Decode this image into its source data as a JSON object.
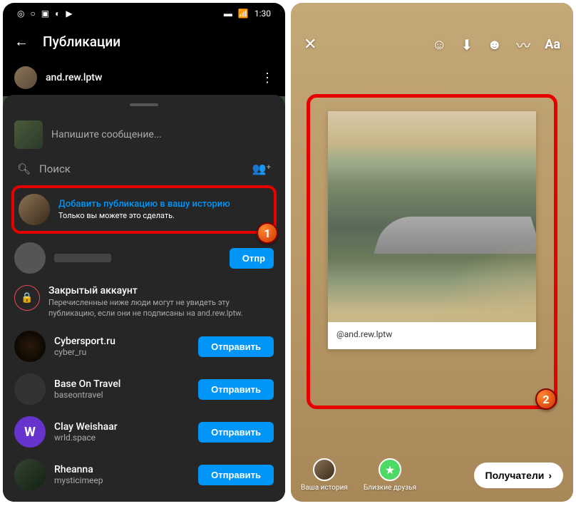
{
  "status": {
    "time": "1:30"
  },
  "left": {
    "header": "Публикации",
    "username": "and.rew.lptw",
    "message_placeholder": "Напишите сообщение...",
    "search_label": "Поиск",
    "highlight": {
      "title": "Добавить публикацию в вашу историю",
      "subtitle": "Только вы можете это сделать."
    },
    "send_label": "Отправить",
    "send_label_cut": "Отпр",
    "locked": {
      "title": "Закрытый аккаунт",
      "desc": "Перечисленные ниже люди могут не увидеть эту публикацию, если они не подписаны на and.rew.lptw."
    },
    "contacts": [
      {
        "name": "Cybersport.ru",
        "sub": "cyber_ru"
      },
      {
        "name": "Base On Travel",
        "sub": "baseontravel"
      },
      {
        "name": "Clay Weishaar",
        "sub": "wrld.space"
      },
      {
        "name": "Rheanna",
        "sub": "mysticimeep"
      }
    ]
  },
  "right": {
    "caption": "@and.rew.lptw",
    "footer": {
      "your_story": "Ваша история",
      "close_friends": "Близкие друзья",
      "recipients": "Получатели"
    }
  },
  "badges": {
    "one": "1",
    "two": "2"
  }
}
